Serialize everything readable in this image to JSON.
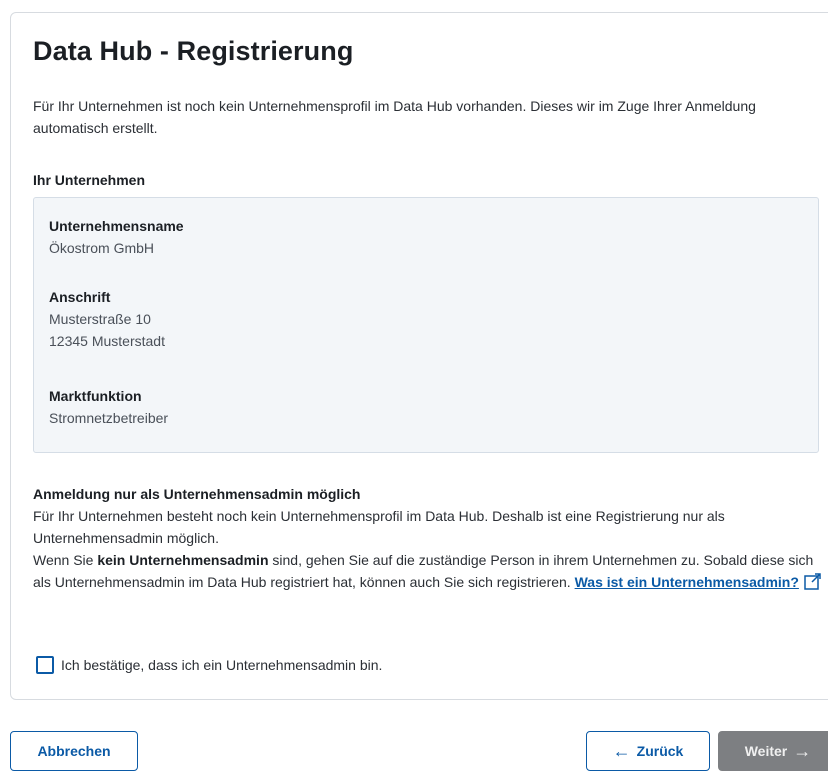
{
  "title": "Data Hub - Registrierung",
  "intro": "Für Ihr Unternehmen ist noch kein Unternehmensprofil im Data Hub vorhanden. Dieses wir im Zuge Ihrer Anmeldung automatisch erstellt.",
  "company_section_label": "Ihr Unternehmen",
  "company": {
    "name_label": "Unternehmensname",
    "name_value": "Ökostrom GmbH",
    "address_label": "Anschrift",
    "address_line1": "Musterstraße 10",
    "address_line2": "12345 Musterstadt",
    "function_label": "Marktfunktion",
    "function_value": "Stromnetzbetreiber"
  },
  "notice": {
    "heading": "Anmeldung nur als Unternehmensadmin möglich",
    "text1": "Für Ihr Unternehmen besteht noch kein Unternehmensprofil im Data Hub. Deshalb ist eine Registrierung nur als Unternehmensadmin möglich.",
    "text2_prefix": "Wenn Sie ",
    "text2_bold": "kein Unternehmensadmin",
    "text2_suffix": " sind, gehen Sie auf die zuständige Person in ihrem Unternehmen zu. Sobald diese sich als Unternehmensadmin im Data Hub registriert hat, können auch Sie sich registrieren. ",
    "link_label": "Was ist ein Unternehmensadmin?"
  },
  "confirm_label": "Ich bestätige, dass ich ein Unternehmensadmin bin.",
  "buttons": {
    "cancel": "Abbrechen",
    "back": "Zurück",
    "next": "Weiter"
  },
  "icons": {
    "back": "arrow-left-icon",
    "next": "arrow-right-icon",
    "external": "external-link-icon"
  },
  "colors": {
    "accent": "#0b5aa6",
    "disabled_button": "#7d7f82",
    "info_box_bg": "#f3f6f9"
  }
}
